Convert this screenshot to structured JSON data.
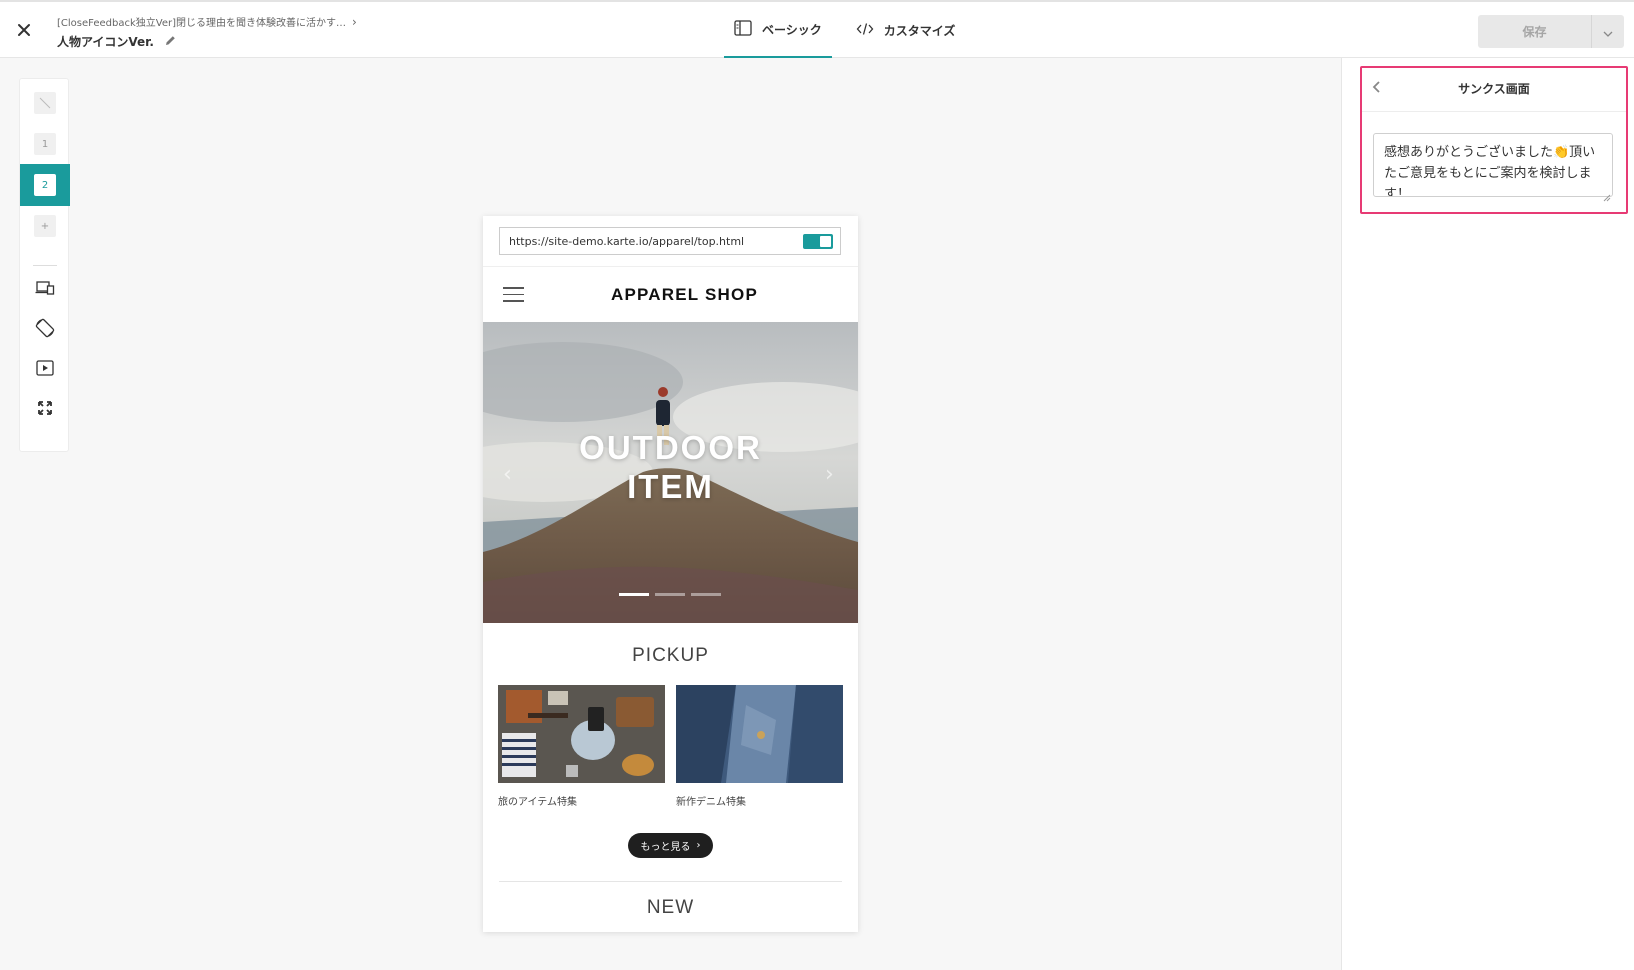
{
  "topbar": {
    "breadcrumb": "[CloseFeedback独立Ver]閉じる理由を聞き体験改善に活かす…",
    "title": "人物アイコンVer.",
    "tabs": [
      {
        "label": "ベーシック",
        "icon": "panel-layout-icon",
        "active": true
      },
      {
        "label": "カスタマイズ",
        "icon": "code-icon",
        "active": false
      }
    ],
    "save_label": "保存"
  },
  "toolstrip": {
    "steps": [
      "1",
      "2"
    ],
    "active_step": "2",
    "icons": [
      "no-step-icon",
      "add-step-icon",
      "device-toggle-icon",
      "rotate-icon",
      "play-preview-icon",
      "fullscreen-icon"
    ]
  },
  "preview": {
    "url": "https://site-demo.karte.io/apparel/top.html",
    "shop_title": "APPAREL SHOP",
    "hero_line1": "OUTDOOR",
    "hero_line2": "ITEM",
    "pickup_title": "PICKUP",
    "cards": [
      {
        "caption": "旅のアイテム特集"
      },
      {
        "caption": "新作デニム特集"
      }
    ],
    "more_label": "もっと見る",
    "new_title": "NEW"
  },
  "panel": {
    "title": "サンクス画面",
    "message": "感想ありがとうございました👏頂いたご意見をもとにご案内を検討します！"
  },
  "colors": {
    "accent": "#1a9b9c",
    "highlight": "#e73a74"
  }
}
